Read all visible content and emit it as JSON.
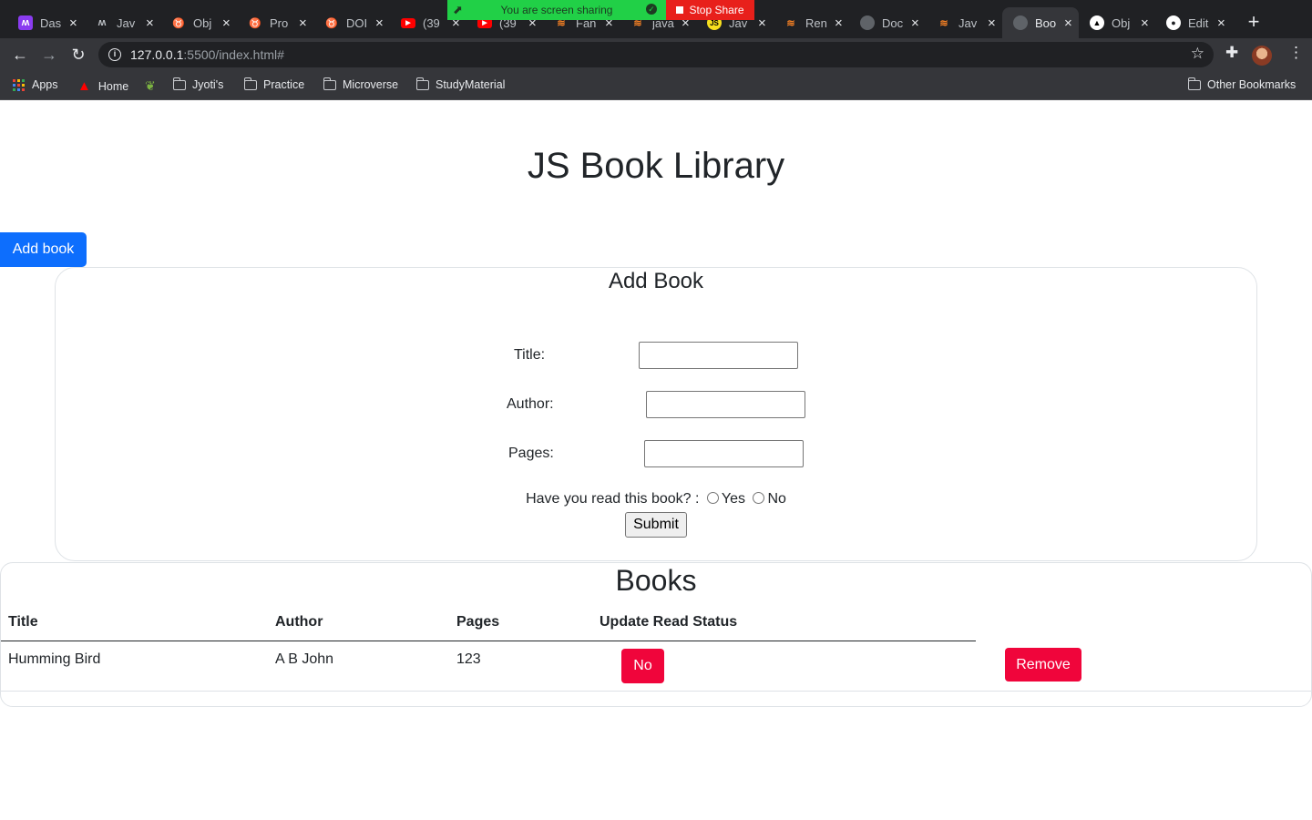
{
  "browser": {
    "tabs": [
      {
        "label": "Das",
        "favicon": "m-logo-icon",
        "color": "#8a3cf0"
      },
      {
        "label": "Jav",
        "favicon": "m-logo-icon",
        "color": "#bdc1c6"
      },
      {
        "label": "Obj",
        "favicon": "fox-icon",
        "color": "#e8a34c"
      },
      {
        "label": "Pro",
        "favicon": "fox-icon",
        "color": "#e8a34c"
      },
      {
        "label": "DOI",
        "favicon": "fox-icon",
        "color": "#e8a34c"
      },
      {
        "label": "(39",
        "favicon": "youtube-icon",
        "color": "#ff0000"
      },
      {
        "label": "(39",
        "favicon": "youtube-icon",
        "color": "#ff0000"
      },
      {
        "label": "Fan",
        "favicon": "stackoverflow-icon",
        "color": "#f48024"
      },
      {
        "label": "java",
        "favicon": "stackoverflow-icon",
        "color": "#f48024"
      },
      {
        "label": "Jav",
        "favicon": "js-icon",
        "color": "#f7df1e"
      },
      {
        "label": "Ren",
        "favicon": "stackoverflow-icon",
        "color": "#f48024"
      },
      {
        "label": "Doc",
        "favicon": "globe-icon",
        "color": "#5f6368"
      },
      {
        "label": "Jav",
        "favicon": "stackoverflow-icon",
        "color": "#f48024"
      },
      {
        "label": "Boo",
        "favicon": "globe-icon",
        "color": "#5f6368",
        "active": true
      },
      {
        "label": "Obj",
        "favicon": "graduation-cap-icon",
        "color": "#ffffff"
      },
      {
        "label": "Edit",
        "favicon": "github-icon",
        "color": "#ffffff"
      }
    ],
    "share_banner": {
      "text": "You are screen sharing",
      "stop_label": "Stop Share"
    },
    "url_host": "127.0.0.1",
    "url_rest": ":5500/index.html#",
    "bookmarks": [
      {
        "label": "Apps",
        "icon": "apps-grid-icon"
      },
      {
        "label": "Home",
        "icon": "adobe-icon"
      },
      {
        "label": "",
        "icon": "leaf-icon"
      },
      {
        "label": "Jyoti's",
        "icon": "folder-icon"
      },
      {
        "label": "Practice",
        "icon": "folder-icon"
      },
      {
        "label": "Microverse",
        "icon": "folder-icon"
      },
      {
        "label": "StudyMaterial",
        "icon": "folder-icon"
      }
    ],
    "other_bookmarks": "Other Bookmarks"
  },
  "page": {
    "title": "JS Book Library",
    "add_book_button": "Add book",
    "form": {
      "heading": "Add Book",
      "title_label": "Title:",
      "title_value": "",
      "author_label": "Author:",
      "author_value": "",
      "pages_label": "Pages:",
      "pages_value": "",
      "read_question": "Have you read this book? :",
      "yes_label": "Yes",
      "no_label": "No",
      "submit_label": "Submit"
    },
    "books": {
      "heading": "Books",
      "columns": [
        "Title",
        "Author",
        "Pages",
        "Update Read Status"
      ],
      "rows": [
        {
          "title": "Humming Bird",
          "author": "A B John",
          "pages": "123",
          "read_status": "No",
          "remove_label": "Remove"
        }
      ]
    }
  },
  "colors": {
    "primary": "#0d6efd",
    "danger": "#f0053b",
    "share_green": "#21d047",
    "share_red": "#e8201b"
  }
}
